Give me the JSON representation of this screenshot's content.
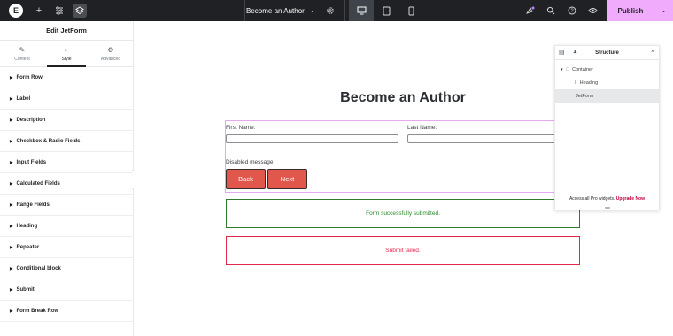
{
  "topbar": {
    "page_title": "Become an Author",
    "publish_label": "Publish"
  },
  "panel": {
    "title": "Edit JetForm",
    "tabs": [
      {
        "label": "Content"
      },
      {
        "label": "Style"
      },
      {
        "label": "Advanced"
      }
    ],
    "sections": [
      "Form Row",
      "Label",
      "Description",
      "Checkbox & Radio Fields",
      "Input Fields",
      "Calculated Fields",
      "Range Fields",
      "Heading",
      "Repeater",
      "Conditional block",
      "Submit",
      "Form Break Row"
    ]
  },
  "canvas": {
    "heading": "Become an Author",
    "first_name_label": "First Name:",
    "last_name_label": "Last Name:",
    "disabled_message": "Disabled message",
    "back_label": "Back",
    "next_label": "Next",
    "success_message": "Form successfully submitted.",
    "fail_message": "Submit failed."
  },
  "structure": {
    "title": "Structure",
    "items": [
      {
        "label": "Container"
      },
      {
        "label": "Heading"
      },
      {
        "label": "JetForm"
      }
    ],
    "footer_text": "Access all Pro widgets.",
    "upgrade_label": "Upgrade Now"
  },
  "colors": {
    "topbar_bg": "#1f2124",
    "publish_bg": "#f0abfc",
    "button_bg": "#e1574c",
    "success": "#2e8b2e",
    "fail": "#e0294b",
    "upgrade": "#c0003c"
  }
}
